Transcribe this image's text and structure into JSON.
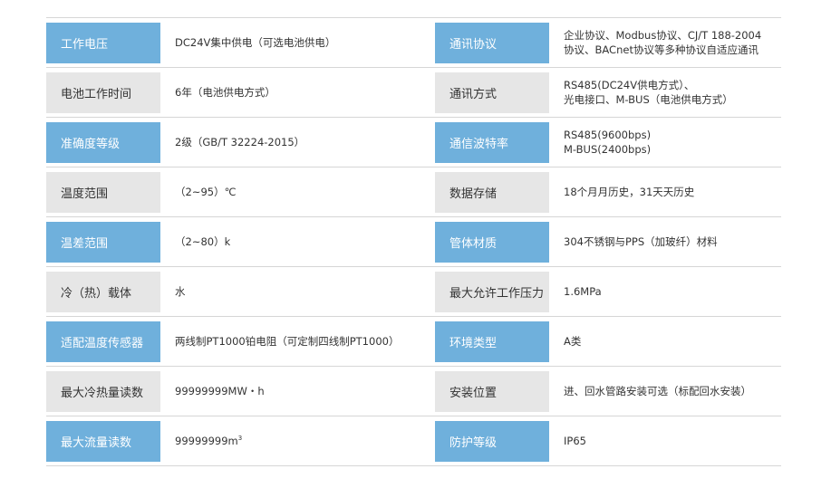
{
  "rows": [
    {
      "left": {
        "label": "工作电压",
        "value": [
          "DC24V集中供电（可选电池供电）"
        ]
      },
      "right": {
        "label": "通讯协议",
        "value": [
          "企业协议、Modbus协议、CJ/T 188-2004",
          "协议、BACnet协议等多种协议自适应通讯"
        ]
      }
    },
    {
      "left": {
        "label": "电池工作时间",
        "value": [
          "6年（电池供电方式）"
        ]
      },
      "right": {
        "label": "通讯方式",
        "value": [
          "RS485(DC24V供电方式）、",
          "光电接口、M-BUS（电池供电方式）"
        ]
      }
    },
    {
      "left": {
        "label": "准确度等级",
        "value": [
          "2级（GB/T 32224-2015）"
        ]
      },
      "right": {
        "label": "通信波特率",
        "value": [
          "RS485(9600bps)",
          "M-BUS(2400bps)"
        ]
      }
    },
    {
      "left": {
        "label": "温度范围",
        "value": [
          "（2~95）℃"
        ]
      },
      "right": {
        "label": "数据存储",
        "value": [
          "18个月月历史，31天天历史"
        ]
      }
    },
    {
      "left": {
        "label": "温差范围",
        "value": [
          "（2~80）k"
        ]
      },
      "right": {
        "label": "管体材质",
        "value": [
          "304不锈钢与PPS（加玻纤）材料"
        ]
      }
    },
    {
      "left": {
        "label": "冷（热）载体",
        "value": [
          "水"
        ]
      },
      "right": {
        "label": "最大允许工作压力",
        "value": [
          "1.6MPa"
        ]
      }
    },
    {
      "left": {
        "label": "适配温度传感器",
        "value": [
          "两线制PT1000铂电阻（可定制四线制PT1000）"
        ]
      },
      "right": {
        "label": "环境类型",
        "value": [
          "A类"
        ]
      }
    },
    {
      "left": {
        "label": "最大冷热量读数",
        "value": [
          "99999999MW・h"
        ]
      },
      "right": {
        "label": "安装位置",
        "value": [
          "进、回水管路安装可选（标配回水安装）"
        ]
      }
    },
    {
      "left": {
        "label": "最大流量读数",
        "value": [
          "99999999m"
        ],
        "sup": "3"
      },
      "right": {
        "label": "防护等级",
        "value": [
          "IP65"
        ]
      }
    }
  ],
  "colors": {
    "blue_label": "#6fb0dc",
    "gray_label": "#e6e6e6",
    "divider": "#d6d6d6",
    "text": "#333333"
  }
}
